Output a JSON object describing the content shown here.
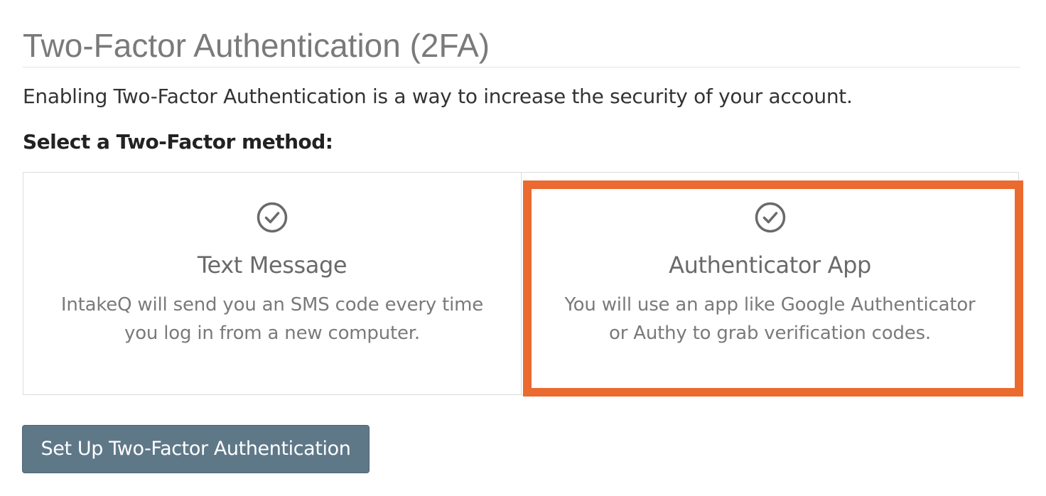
{
  "page": {
    "title": "Two-Factor Authentication (2FA)",
    "intro": "Enabling Two-Factor Authentication is a way to increase the security of your account.",
    "select_label": "Select a Two-Factor method:"
  },
  "methods": [
    {
      "icon": "check-circle-icon",
      "title": "Text Message",
      "description": "IntakeQ will send you an SMS code every time you log in from a new computer."
    },
    {
      "icon": "check-circle-icon",
      "title": "Authenticator App",
      "description": "You will use an app like Google Authenticator or Authy to grab verification codes."
    }
  ],
  "setup_button": {
    "label": "Set Up Two-Factor Authentication"
  },
  "colors": {
    "title": "#7a7a7a",
    "button": "#5f7888",
    "highlight": "#ea6a2f",
    "icon": "#6a6a6a"
  }
}
